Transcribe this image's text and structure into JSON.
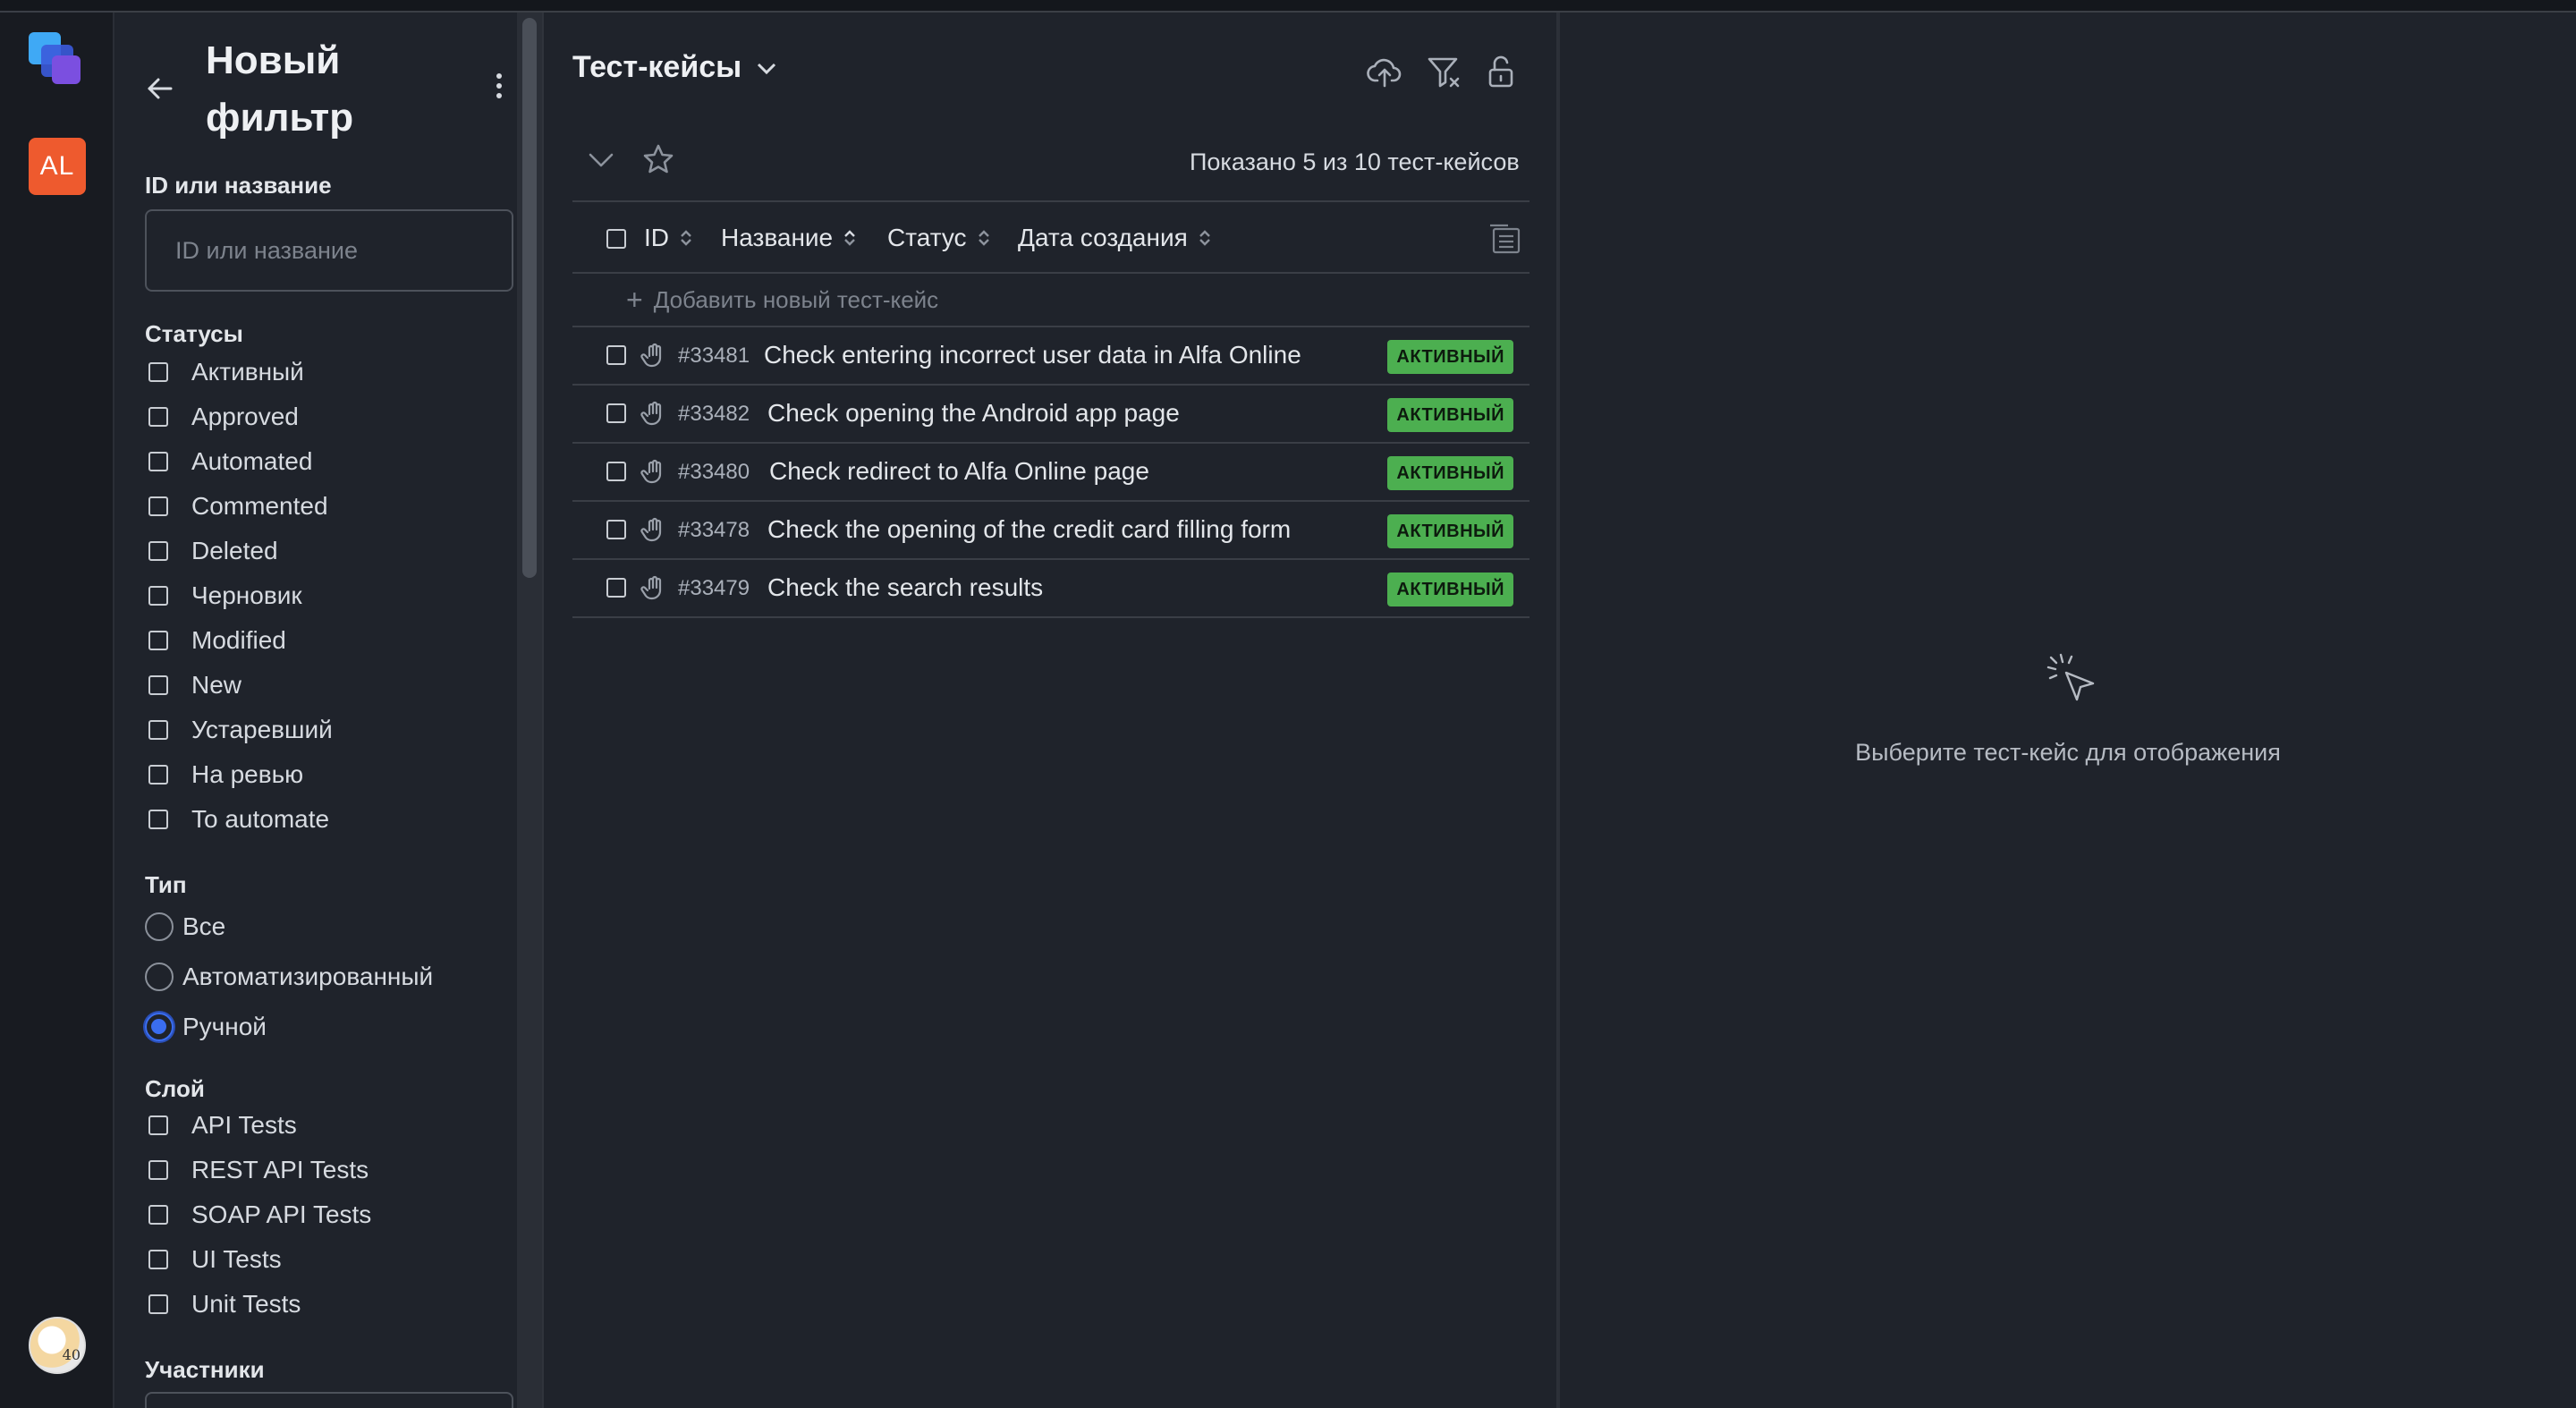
{
  "rail": {
    "user_initials": "AL",
    "avatar_badge": "40",
    "items": [
      {
        "icon": "dashboard-icon"
      },
      {
        "icon": "test-cases-icon"
      },
      {
        "icon": "refresh-icon"
      },
      {
        "icon": "clipboard-check-icon"
      },
      {
        "icon": "rocket-icon"
      },
      {
        "icon": "report-search-icon"
      },
      {
        "icon": "bug-icon"
      },
      {
        "icon": "test-run-icon"
      },
      {
        "icon": "settings-icon"
      },
      {
        "icon": "add-icon"
      },
      {
        "icon": "help-icon"
      }
    ]
  },
  "filter": {
    "title": "Новый фильтр",
    "search_label": "ID или название",
    "search_placeholder": "ID или название",
    "search_value": "",
    "statuses_label": "Статусы",
    "statuses": [
      "Активный",
      "Approved",
      "Automated",
      "Commented",
      "Deleted",
      "Черновик",
      "Modified",
      "New",
      "Устаревший",
      "На ревью",
      "To automate"
    ],
    "type_label": "Тип",
    "types": [
      {
        "label": "Все",
        "checked": false
      },
      {
        "label": "Автоматизированный",
        "checked": false
      },
      {
        "label": "Ручной",
        "checked": true
      }
    ],
    "layer_label": "Слой",
    "layers": [
      "API Tests",
      "REST API Tests",
      "SOAP API Tests",
      "UI Tests",
      "Unit Tests"
    ],
    "members_label": "Участники"
  },
  "cases_panel": {
    "title": "Тест-кейсы",
    "shown_count": "Показано 5 из 10 тест-кейсов",
    "columns": {
      "id": "ID",
      "name": "Название",
      "status": "Статус",
      "created": "Дата создания"
    },
    "add_label": "Добавить новый тест-кейс",
    "rows": [
      {
        "id": "#33481",
        "name": "Check entering incorrect user data in Alfa Online",
        "status": "АКТИВНЫЙ"
      },
      {
        "id": "#33482",
        "name": "Check opening the Android app page",
        "status": "АКТИВНЫЙ"
      },
      {
        "id": "#33480",
        "name": "Check redirect to Alfa Online page",
        "status": "АКТИВНЫЙ"
      },
      {
        "id": "#33478",
        "name": "Check the opening of the credit card filling form",
        "status": "АКТИВНЫЙ"
      },
      {
        "id": "#33479",
        "name": "Check the search results",
        "status": "АКТИВНЫЙ"
      }
    ]
  },
  "detail": {
    "empty_text": "Выберите тест-кейс для отображения"
  },
  "colors": {
    "accent": "#3a6df0",
    "status_active": "#4caf50",
    "avatar_bg": "#ee5a2e"
  }
}
